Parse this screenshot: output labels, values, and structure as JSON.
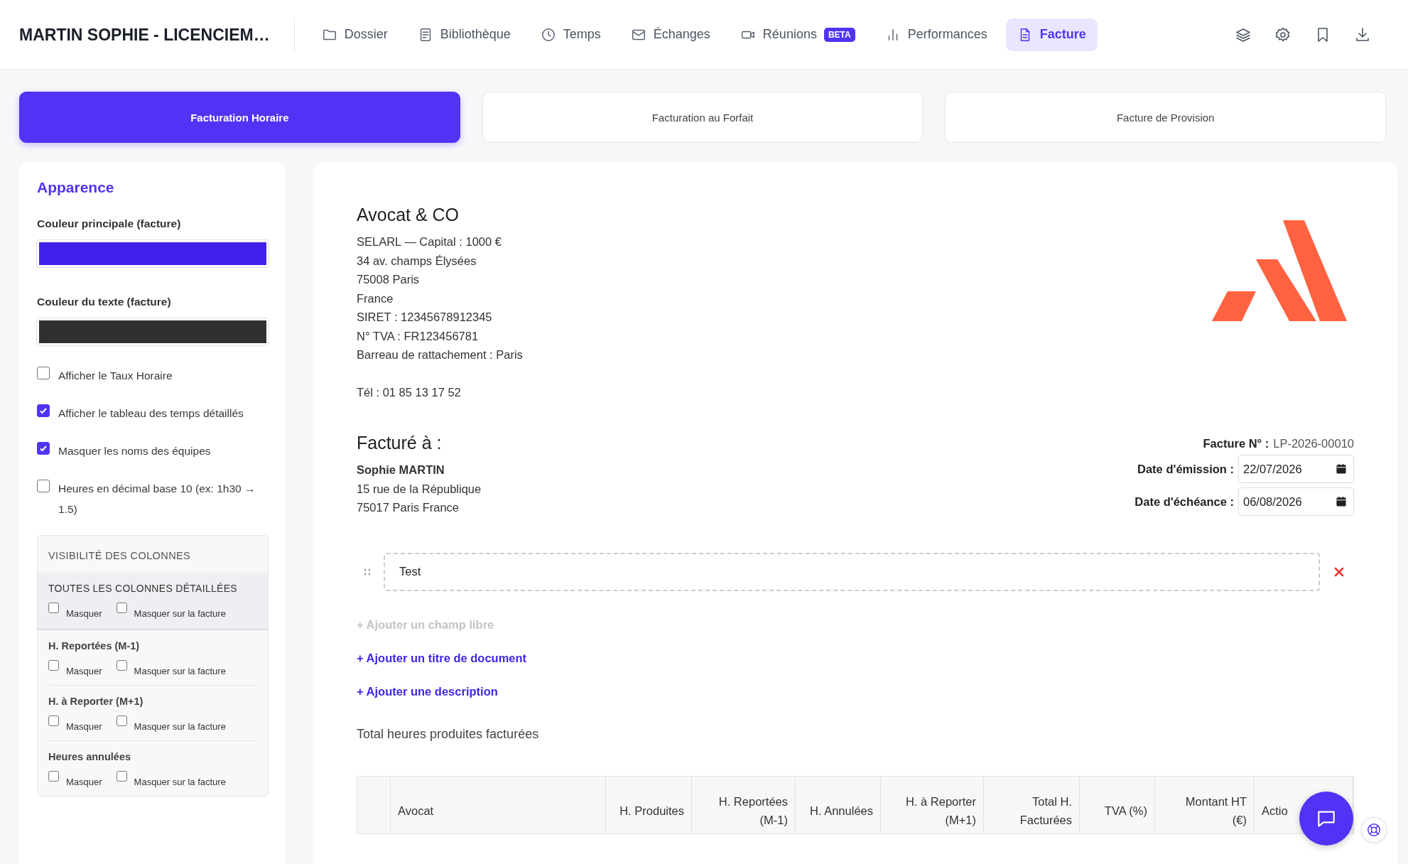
{
  "header": {
    "title": "MARTIN SOPHIE - LICENCIEM…",
    "nav": [
      {
        "label": "Dossier",
        "selected": false
      },
      {
        "label": "Bibliothèque",
        "selected": false
      },
      {
        "label": "Temps",
        "selected": false
      },
      {
        "label": "Échanges",
        "selected": false
      },
      {
        "label": "Réunions",
        "badge": "BETA",
        "selected": false
      },
      {
        "label": "Performances",
        "selected": false
      },
      {
        "label": "Facture",
        "selected": true
      }
    ]
  },
  "billing_tabs": [
    {
      "label": "Facturation Horaire",
      "selected": true
    },
    {
      "label": "Facturation au Forfait",
      "selected": false
    },
    {
      "label": "Facture de Provision",
      "selected": false
    }
  ],
  "appearance": {
    "title": "Apparence",
    "colors": [
      {
        "label": "Couleur principale (facture)",
        "color": "#4220ec"
      },
      {
        "label": "Couleur du texte (facture)",
        "color": "#303030"
      }
    ],
    "options": [
      {
        "label": "Afficher le Taux Horaire",
        "checked": false
      },
      {
        "label": "Afficher le tableau des temps détaillés",
        "checked": true
      },
      {
        "label": "Masquer les noms des équipes",
        "checked": true
      },
      {
        "label": "Heures en décimal base 10 (ex: 1h30 → 1.5)",
        "checked": false
      }
    ],
    "column_visibility": {
      "title": "VISIBILITÉ DES COLONNES",
      "groups": [
        {
          "kind": "all",
          "label": "TOUTES LES COLONNES DÉTAILLÉES",
          "options": [
            {
              "label": "Masquer",
              "checked": false
            },
            {
              "label": "Masquer sur la facture",
              "checked": false
            }
          ]
        },
        {
          "kind": "column",
          "label": "H. Reportées (M-1)",
          "options": [
            {
              "label": "Masquer",
              "checked": false
            },
            {
              "label": "Masquer sur la facture",
              "checked": false
            }
          ]
        },
        {
          "kind": "column",
          "label": "H. à Reporter (M+1)",
          "options": [
            {
              "label": "Masquer",
              "checked": false
            },
            {
              "label": "Masquer sur la facture",
              "checked": false
            }
          ]
        },
        {
          "kind": "column",
          "label": "Heures annulées",
          "options": [
            {
              "label": "Masquer",
              "checked": false
            },
            {
              "label": "Masquer sur la facture",
              "checked": false
            }
          ]
        }
      ]
    }
  },
  "invoice": {
    "company": {
      "name": "Avocat & CO",
      "lines": [
        "SELARL — Capital : 1000 €",
        "34 av. champs Élysées",
        "75008 Paris",
        "France",
        "SIRET : 12345678912345",
        "N° TVA : FR123456781",
        "Barreau de rattachement : Paris"
      ],
      "phone": "Tél : 01 85 13 17 52"
    },
    "billed_to": {
      "heading": "Facturé à :",
      "client": "Sophie MARTIN",
      "lines": [
        "15 rue de la République",
        "75017 Paris France"
      ]
    },
    "meta": {
      "number_label": "Facture N° :",
      "number": "LP-2026-00010",
      "dates": [
        {
          "label": "Date d'émission :",
          "value": "22/07/2026"
        },
        {
          "label": "Date d'échéance :",
          "value": "06/08/2026"
        }
      ]
    },
    "free_fields": [
      {
        "value": "Test"
      }
    ],
    "links": [
      {
        "label": "+ Ajouter un champ libre",
        "disabled": true
      },
      {
        "label": "+ Ajouter un titre de document",
        "disabled": false
      },
      {
        "label": "+ Ajouter une description",
        "disabled": false
      }
    ],
    "section_title": "Total heures produites facturées",
    "table": {
      "columns": [
        {
          "label": "Avocat"
        },
        {
          "label": "H. Produites"
        },
        {
          "label": "H. Reportées (M-1)"
        },
        {
          "label": "H. Annulées"
        },
        {
          "label": "H. à Reporter (M+1)"
        },
        {
          "label": "Total H. Facturées"
        },
        {
          "label": "TVA (%)"
        },
        {
          "label": "Montant HT (€)"
        },
        {
          "label": "Actio"
        }
      ]
    }
  }
}
